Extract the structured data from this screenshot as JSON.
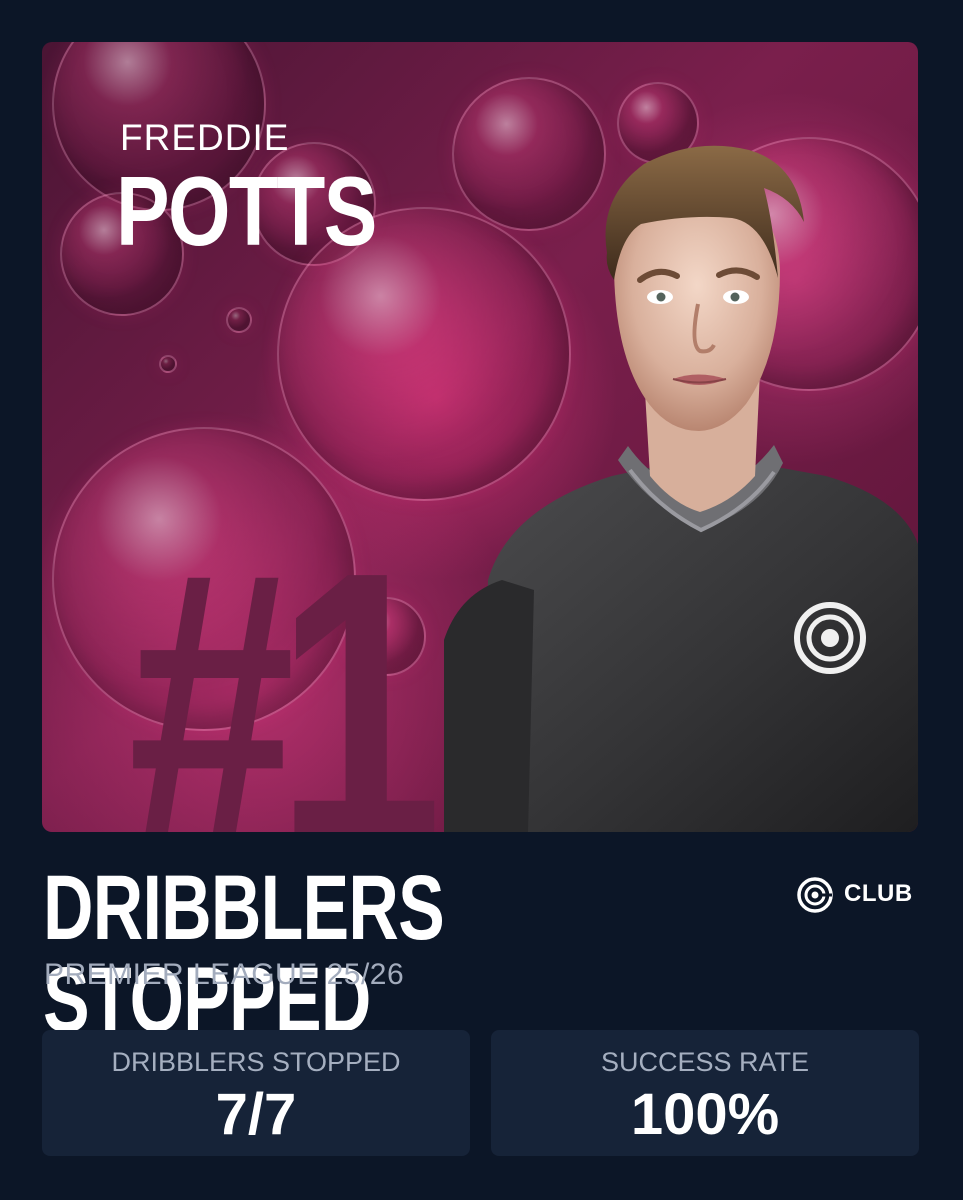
{
  "player": {
    "first_name": "FREDDIE",
    "last_name": "POTTS",
    "rank": "#1"
  },
  "stat": {
    "title": "DRIBBLERS STOPPED",
    "subtitle": "PREMIER LEAGUE 25/26"
  },
  "brand": {
    "name": "CLUB"
  },
  "cards": [
    {
      "label": "DRIBBLERS STOPPED",
      "value": "7/7"
    },
    {
      "label": "SUCCESS RATE",
      "value": "100%"
    }
  ],
  "colors": {
    "page_background": "#0c1627",
    "card_background": "#162338",
    "hero_pink": "#d63b84",
    "hero_dark": "#4a1534",
    "rank_color": "#6a1f45",
    "text_primary": "#ffffff",
    "text_secondary": "#a3acbd"
  }
}
